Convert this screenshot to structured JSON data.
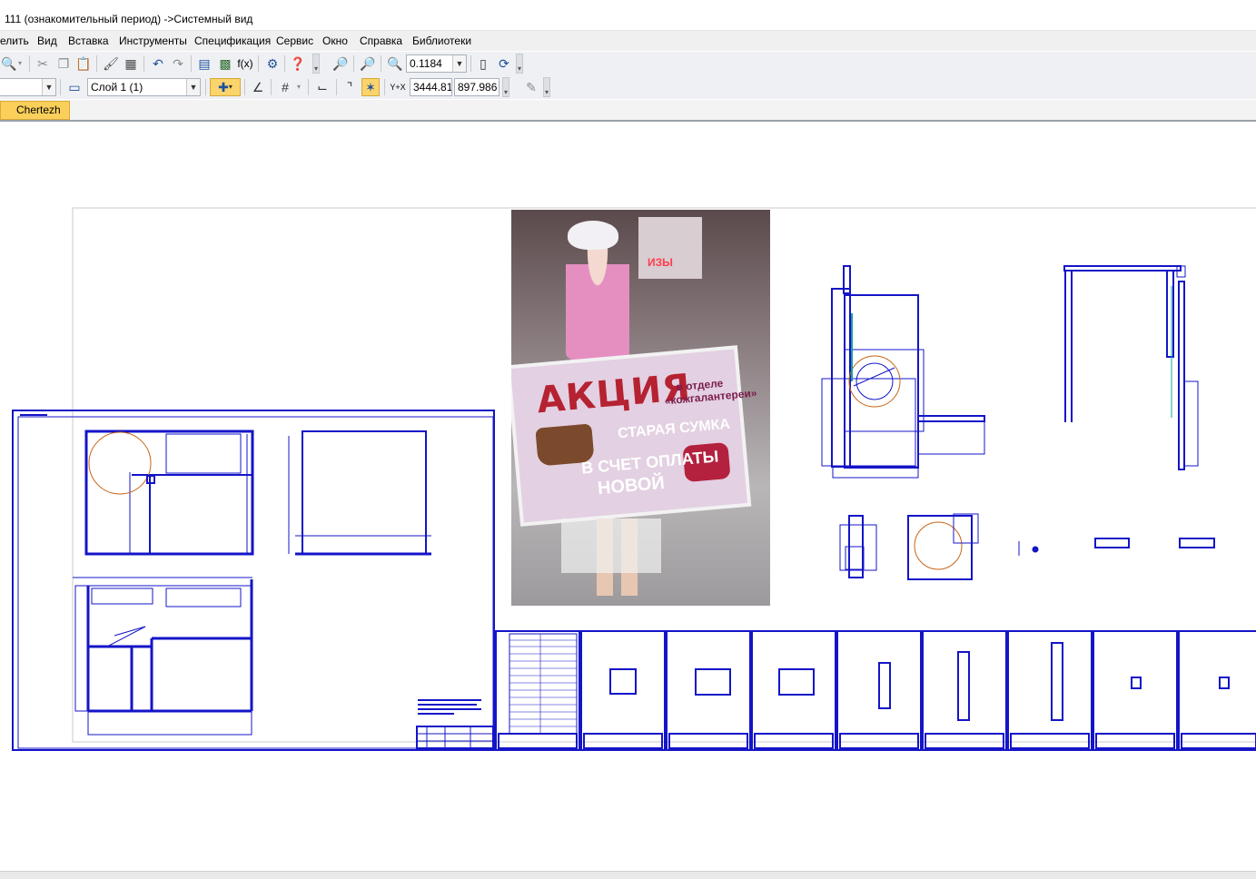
{
  "window": {
    "title": "111 (ознакомительный период) ->Системный вид"
  },
  "menu": {
    "items": [
      {
        "label": "елить",
        "id": "edit"
      },
      {
        "label": "Вид",
        "id": "view"
      },
      {
        "label": "Вставка",
        "id": "insert"
      },
      {
        "label": "Инструменты",
        "id": "tools"
      },
      {
        "label": "Спецификация",
        "id": "specification"
      },
      {
        "label": "Сервис",
        "id": "service"
      },
      {
        "label": "Окно",
        "id": "window"
      },
      {
        "label": "Справка",
        "id": "help"
      },
      {
        "label": "Библиотеки",
        "id": "libraries"
      }
    ]
  },
  "toolbar1": {
    "zoom_value": "0.1184",
    "icons": [
      "print-preview-icon",
      "cut-icon",
      "copy-icon",
      "paste-icon",
      "format-brush-icon",
      "properties-icon",
      "undo-icon",
      "redo-icon",
      "manager-icon",
      "library-icon",
      "formula-icon",
      "variables-icon",
      "help-pointer-icon",
      "zoom-window-icon",
      "zoom-all-icon",
      "zoom-in-icon",
      "refresh-icon",
      "regenerate-icon"
    ]
  },
  "toolbar2": {
    "layer_value": "Слой 1 (1)",
    "coord_label": "Y+X",
    "coord_x": "3444.81",
    "coord_y": "897.986",
    "icons": [
      "layer-icon",
      "snap-icon",
      "ortho-icon",
      "grid-icon",
      "local-cs-icon",
      "round-icon",
      "binding-icon",
      "parameters-icon"
    ]
  },
  "tabs": [
    {
      "label": "Chertezh",
      "active": true
    }
  ],
  "photo": {
    "sign_title": "АКЦИЯ",
    "sign_dept": "в отделе «кожгалантереи»",
    "sign_old": "СТАРАЯ СУМКА",
    "sign_pay": "В СЧЕТ ОПЛАТЫ",
    "sign_new": "НОВОЙ",
    "store_neon": "ИЗЫ"
  },
  "colors": {
    "accent_tab": "#fbd05a",
    "drawing_line": "#1414c8",
    "drawing_circle": "#c86414",
    "menu_bg": "#f0f0f0",
    "toolbar_bg": "#eef0f3"
  }
}
